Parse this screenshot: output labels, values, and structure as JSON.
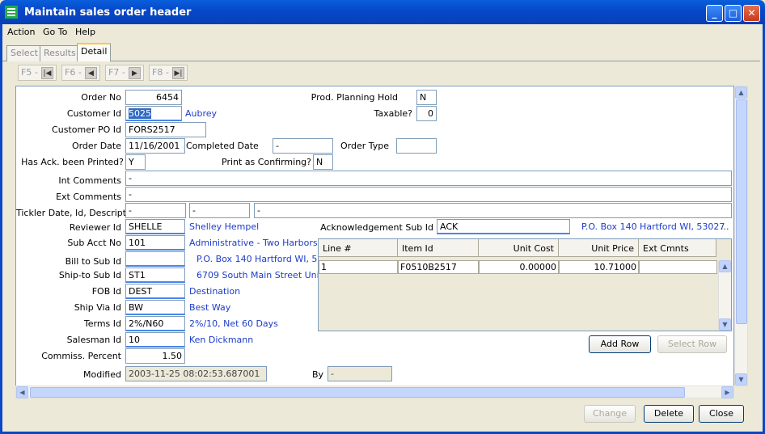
{
  "window": {
    "title": "Maintain sales order header"
  },
  "menu": {
    "action": "Action",
    "goto": "Go To",
    "help": "Help"
  },
  "tabs": {
    "select": "Select",
    "results": "Results",
    "detail": "Detail"
  },
  "nav": {
    "f5": "F5 -",
    "f6": "F6 -",
    "f7": "F7 -",
    "f8": "F8 -"
  },
  "form": {
    "order_no_label": "Order No",
    "order_no": "6454",
    "customer_id_label": "Customer Id",
    "customer_id": "5025",
    "customer_name": "Aubrey",
    "customer_po_label": "Customer PO Id",
    "customer_po": "FORS2517",
    "order_date_label": "Order Date",
    "order_date": "11/16/2001",
    "completed_date_label": "Completed Date",
    "completed_date": "-",
    "order_type_label": "Order Type",
    "order_type": "",
    "ack_printed_label": "Has Ack. been Printed?",
    "ack_printed": "Y",
    "print_confirming_label": "Print as Confirming?",
    "print_confirming": "N",
    "prod_hold_label": "Prod. Planning Hold",
    "prod_hold": "N",
    "taxable_label": "Taxable?",
    "taxable": "0",
    "int_comments_label": "Int Comments",
    "int_comments": "-",
    "ext_comments_label": "Ext Comments",
    "ext_comments": "-",
    "tickler_label": "Tickler Date, Id, Descript...",
    "tickler_date": "-",
    "tickler_id": "-",
    "tickler_desc": "-",
    "reviewer_label": "Reviewer Id",
    "reviewer": "SHELLE",
    "reviewer_name": "Shelley Hempel",
    "ack_sub_label": "Acknowledgement Sub Id",
    "ack_sub": "ACK",
    "ack_addr": "P.O. Box 140 Hartford WI, 53027",
    "ack_more": "...",
    "sub_acct_label": "Sub Acct No",
    "sub_acct": "101",
    "sub_acct_name": "Administrative - Two Harbors",
    "bill_sub_label": "Bill to Sub Id",
    "bill_sub": "",
    "bill_addr": "P.O. Box 140 Hartford WI, 5...",
    "ship_sub_label": "Ship-to Sub Id",
    "ship_sub": "ST1",
    "ship_addr": "6709 South Main Street Uni...",
    "fob_label": "FOB Id",
    "fob": "DEST",
    "fob_name": "Destination",
    "ship_via_label": "Ship Via Id",
    "ship_via": "BW",
    "ship_via_name": "Best Way",
    "terms_label": "Terms Id",
    "terms": "2%/N60",
    "terms_name": "2%/10, Net 60 Days",
    "salesman_label": "Salesman Id",
    "salesman": "10",
    "salesman_name": "Ken Dickmann",
    "commiss_label": "Commiss. Percent",
    "commiss": "1.50",
    "modified_label": "Modified",
    "modified": "2003-11-25 08:02:53.687001",
    "by_label": "By",
    "by": "-"
  },
  "grid": {
    "headers": [
      "Line #",
      "Item Id",
      "Unit Cost",
      "Unit Price",
      "Ext Cmnts"
    ],
    "rows": [
      [
        "1",
        "F0510B2517",
        "0.00000",
        "10.71000",
        ""
      ]
    ]
  },
  "buttons": {
    "add_row": "Add Row",
    "select_row": "Select Row",
    "change": "Change",
    "delete": "Delete",
    "close": "Close"
  }
}
